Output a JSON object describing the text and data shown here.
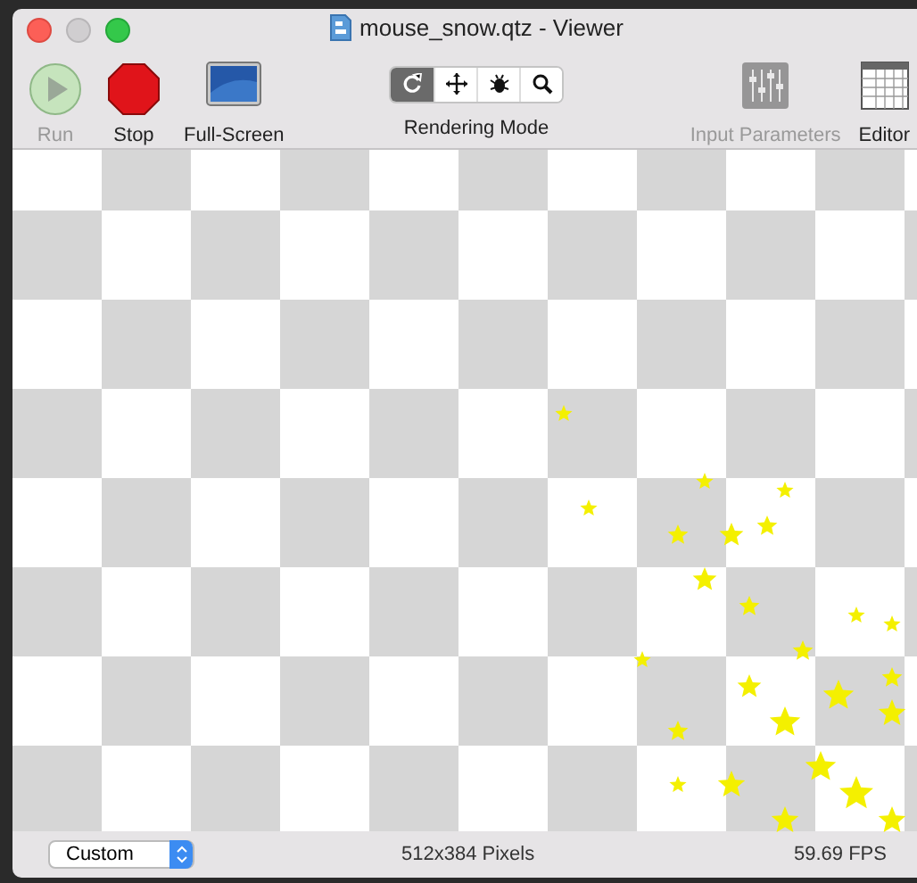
{
  "window": {
    "title": "mouse_snow.qtz - Viewer"
  },
  "toolbar": {
    "left": [
      {
        "kind": "run",
        "label": "Run",
        "disabled": true
      },
      {
        "kind": "stop",
        "label": "Stop",
        "disabled": false
      },
      {
        "kind": "fullscreen",
        "label": "Full-Screen",
        "disabled": false
      }
    ],
    "rendering_mode": {
      "label": "Rendering Mode",
      "segments": [
        {
          "kind": "rotate",
          "selected": true
        },
        {
          "kind": "move",
          "selected": false
        },
        {
          "kind": "bug",
          "selected": false
        },
        {
          "kind": "zoom",
          "selected": false
        }
      ]
    },
    "right": [
      {
        "kind": "parameters",
        "label": "Input Parameters",
        "disabled": true
      },
      {
        "kind": "editor",
        "label": "Editor",
        "disabled": false
      }
    ]
  },
  "status_bar": {
    "size_preset": "Custom",
    "dimensions": "512x384 Pixels",
    "fps": "59.69 FPS"
  }
}
